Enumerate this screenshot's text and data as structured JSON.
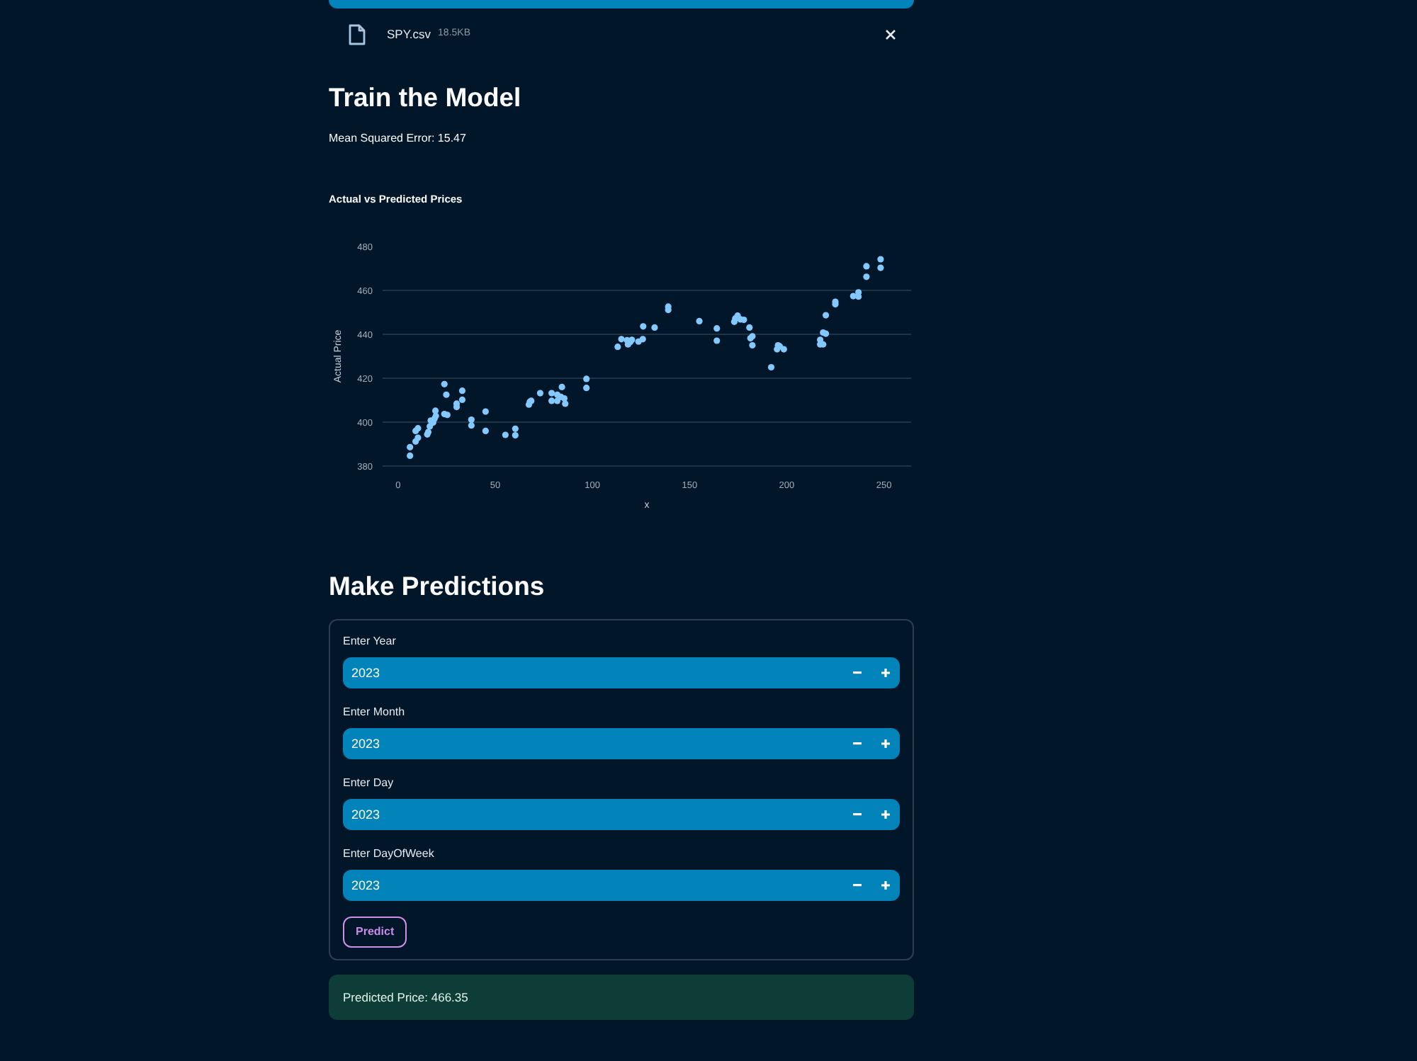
{
  "uploader": {
    "file": {
      "name": "SPY.csv",
      "size": "18.5KB"
    }
  },
  "train": {
    "heading": "Train the Model",
    "metric": "Mean Squared Error: 15.47",
    "chart_data": {
      "type": "scatter",
      "title": "Actual vs Predicted Prices",
      "xlabel": "x",
      "ylabel": "Actual Price",
      "grid": true,
      "x": [
        6.1,
        6.1,
        9,
        10.2,
        9,
        10.2,
        15,
        15.5,
        16.3,
        16.8,
        18,
        18.7,
        19.4,
        19.2,
        23.8,
        24.8,
        23.8,
        25.3,
        30.1,
        30.1,
        33,
        33,
        37.7,
        37.7,
        45,
        45,
        55.2,
        60.3,
        60.3,
        67.3,
        67.8,
        68.5,
        73.1,
        79,
        79,
        81.9,
        81.9,
        83.8,
        84.3,
        85.5,
        86,
        96.9,
        96.9,
        113,
        114.9,
        117.8,
        118.3,
        119.5,
        120.3,
        123.7,
        125.9,
        126.1,
        132,
        139,
        139,
        155,
        164,
        164,
        173,
        173.5,
        174.7,
        176.2,
        177.9,
        180.8,
        181.3,
        182.3,
        182.3,
        192,
        195,
        195.5,
        196.4,
        198.5,
        217.2,
        217.2,
        218.7,
        218.7,
        220.1,
        220.1,
        225,
        225,
        234.2,
        236.9,
        236.9,
        241,
        241,
        248.3,
        248.3
      ],
      "series": [
        {
          "color": "#83c9ff",
          "values": [
            384.7,
            388.6,
            391.2,
            392.9,
            396,
            397.2,
            394.4,
            395.5,
            398.1,
            400.7,
            399.8,
            401.5,
            402.8,
            405.2,
            417.3,
            412.5,
            403.7,
            403.3,
            408.4,
            406.9,
            414.3,
            410.2,
            401.1,
            398.5,
            404.8,
            396,
            394.2,
            397,
            394,
            408,
            409.3,
            409.7,
            413.2,
            413.2,
            409.7,
            412.5,
            409.7,
            411.5,
            416,
            410.8,
            408.4,
            419.7,
            415.6,
            434.3,
            437.8,
            437.3,
            435.4,
            436.5,
            437.5,
            436.7,
            437.8,
            443.6,
            443.1,
            452.6,
            451.1,
            446,
            442.7,
            437.1,
            445.7,
            447.2,
            448.5,
            446.8,
            446.6,
            443.1,
            438.2,
            439.1,
            435,
            425,
            433.2,
            435,
            434.5,
            433.2,
            437.5,
            435.4,
            435.4,
            440.8,
            440.3,
            448.7,
            454.8,
            453.7,
            457.4,
            457.2,
            459.1,
            471,
            466.2,
            474.2,
            470.3
          ]
        }
      ],
      "xticks": [
        0,
        50,
        100,
        150,
        200,
        250
      ],
      "yticks": [
        380,
        400,
        420,
        440,
        460,
        480
      ],
      "xlim": [
        -8,
        264
      ],
      "ylim": [
        380,
        480
      ]
    }
  },
  "predict": {
    "heading": "Make Predictions",
    "fields": [
      {
        "label": "Enter Year",
        "value": "2023"
      },
      {
        "label": "Enter Month",
        "value": "2023"
      },
      {
        "label": "Enter Day",
        "value": "2023"
      },
      {
        "label": "Enter DayOfWeek",
        "value": "2023"
      }
    ],
    "button": "Predict"
  },
  "result": {
    "text": "Predicted Price: 466.35"
  }
}
